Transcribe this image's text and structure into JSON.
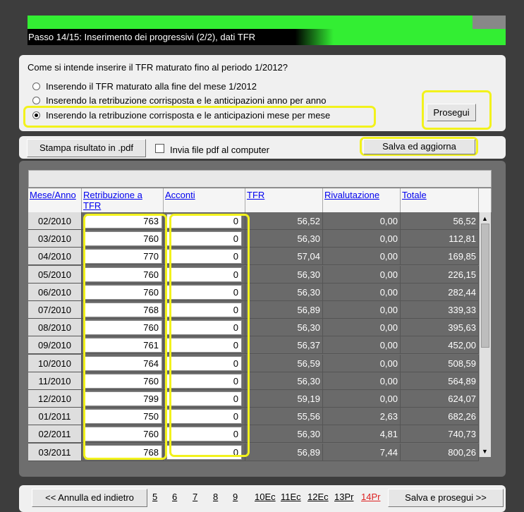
{
  "header": {
    "step_label": "Passo 14/15: Inserimento dei progressivi (2/2), dati TFR",
    "progress": 0.93
  },
  "question": {
    "title": "Come si intende inserire il TFR maturato fino al periodo 1/2012?",
    "options": [
      "Inserendo il TFR maturato alla fine del mese 1/2012",
      "Inserendo la retribuzione corrisposta e le anticipazioni anno per anno",
      "Inserendo la retribuzione corrisposta e le anticipazioni mese per mese"
    ],
    "selected_index": 2,
    "continue_label": "Prosegui"
  },
  "toolbar": {
    "print_label": "Stampa risultato in .pdf",
    "send_pdf_label": "Invia file pdf al computer",
    "save_update_label": "Salva ed aggiorna"
  },
  "table": {
    "columns": [
      "Mese/Anno",
      "Retribuzione a TFR",
      "Acconti",
      "TFR",
      "Rivalutazione",
      "Totale"
    ],
    "rows": [
      [
        "02/2010",
        "763",
        "0",
        "56,52",
        "0,00",
        "56,52"
      ],
      [
        "03/2010",
        "760",
        "0",
        "56,30",
        "0,00",
        "112,81"
      ],
      [
        "04/2010",
        "770",
        "0",
        "57,04",
        "0,00",
        "169,85"
      ],
      [
        "05/2010",
        "760",
        "0",
        "56,30",
        "0,00",
        "226,15"
      ],
      [
        "06/2010",
        "760",
        "0",
        "56,30",
        "0,00",
        "282,44"
      ],
      [
        "07/2010",
        "768",
        "0",
        "56,89",
        "0,00",
        "339,33"
      ],
      [
        "08/2010",
        "760",
        "0",
        "56,30",
        "0,00",
        "395,63"
      ],
      [
        "09/2010",
        "761",
        "0",
        "56,37",
        "0,00",
        "452,00"
      ],
      [
        "10/2010",
        "764",
        "0",
        "56,59",
        "0,00",
        "508,59"
      ],
      [
        "11/2010",
        "760",
        "0",
        "56,30",
        "0,00",
        "564,89"
      ],
      [
        "12/2010",
        "799",
        "0",
        "59,19",
        "0,00",
        "624,07"
      ],
      [
        "01/2011",
        "750",
        "0",
        "55,56",
        "2,63",
        "682,26"
      ],
      [
        "02/2011",
        "760",
        "0",
        "56,30",
        "4,81",
        "740,73"
      ],
      [
        "03/2011",
        "768",
        "0",
        "56,89",
        "7,44",
        "800,26"
      ]
    ]
  },
  "footer": {
    "back_label": "<< Annulla ed indietro",
    "pages": [
      "5",
      "6",
      "7",
      "8",
      "9",
      "10Ec",
      "11Ec",
      "12Ec",
      "13Pr",
      "14Pr"
    ],
    "current_page": "14Pr",
    "next_label": "Salva e prosegui >>"
  },
  "colors": {
    "progress_green": "#33ee33",
    "highlight_yellow": "#f2f21c",
    "link_blue": "#0000ee",
    "current_page_red": "#dd2222"
  }
}
